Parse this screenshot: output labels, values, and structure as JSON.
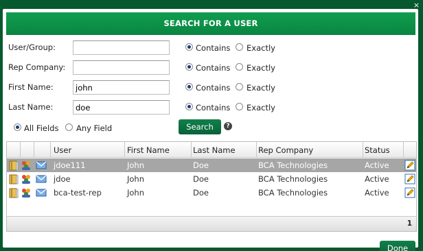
{
  "dialog": {
    "title": "SEARCH FOR A USER",
    "close_glyph": "×"
  },
  "form": {
    "fields": [
      {
        "label": "User/Group:",
        "value": "",
        "contains_label": "Contains",
        "exactly_label": "Exactly",
        "mode": "contains"
      },
      {
        "label": "Rep Company:",
        "value": "",
        "contains_label": "Contains",
        "exactly_label": "Exactly",
        "mode": "contains"
      },
      {
        "label": "First Name:",
        "value": "john",
        "contains_label": "Contains",
        "exactly_label": "Exactly",
        "mode": "contains"
      },
      {
        "label": "Last Name:",
        "value": "doe",
        "contains_label": "Contains",
        "exactly_label": "Exactly",
        "mode": "contains"
      }
    ],
    "match_all_label": "All Fields",
    "match_any_label": "Any Field",
    "match_mode": "all",
    "search_label": "Search",
    "help_glyph": "?"
  },
  "results": {
    "columns": [
      "User",
      "First Name",
      "Last Name",
      "Rep Company",
      "Status"
    ],
    "rows": [
      {
        "user": "jdoe111",
        "first": "John",
        "last": "Doe",
        "company": "BCA Technologies",
        "status": "Active",
        "selected": true
      },
      {
        "user": "jdoe",
        "first": "John",
        "last": "Doe",
        "company": "BCA Technologies",
        "status": "Active",
        "selected": false
      },
      {
        "user": "bca-test-rep",
        "first": "John",
        "last": "Doe",
        "company": "BCA Technologies",
        "status": "Active",
        "selected": false
      }
    ],
    "row_icons": [
      "book-icon",
      "group-icon",
      "envelope-icon",
      "edit-icon"
    ],
    "page": "1"
  },
  "footer": {
    "done_label": "Done"
  },
  "colors": {
    "frame": "#06592e",
    "header": "#0f9e4f",
    "button": "#0a7040",
    "selected_row": "#a6a6a6"
  }
}
